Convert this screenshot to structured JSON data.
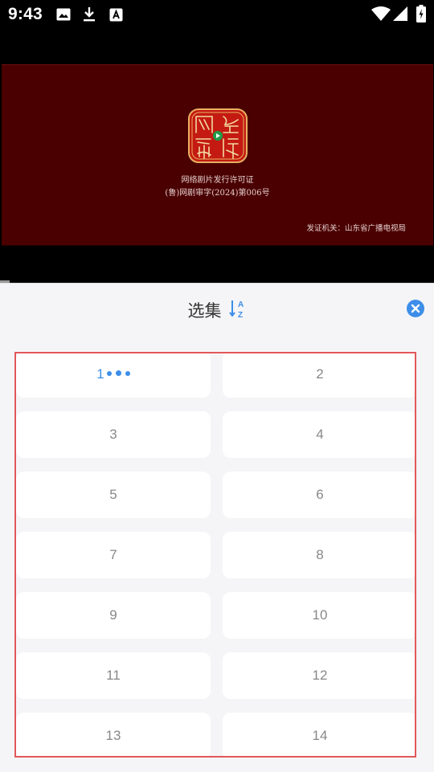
{
  "status_bar": {
    "time": "9:43",
    "left_icons": [
      "image-icon",
      "download-icon",
      "text-a-icon"
    ],
    "right_icons": [
      "wifi-icon",
      "signal-icon",
      "battery-icon"
    ]
  },
  "license_card": {
    "seal_text": "网络视听",
    "title": "网络剧片发行许可证",
    "number": "(鲁)网剧审字(2024)第006号",
    "issuer": "发证机关：山东省广播电视局"
  },
  "episode_sheet": {
    "title": "选集",
    "sort_icon": "sort-a-z-icon",
    "close_icon": "close-icon",
    "playing_episode": "1",
    "episodes": [
      "1",
      "2",
      "3",
      "4",
      "5",
      "6",
      "7",
      "8",
      "9",
      "10",
      "11",
      "12",
      "13",
      "14"
    ]
  },
  "colors": {
    "accent": "#3d8ee8",
    "highlight_border": "#e2585a",
    "license_bg": "#4a0000",
    "sheet_bg": "#f5f5f7"
  }
}
